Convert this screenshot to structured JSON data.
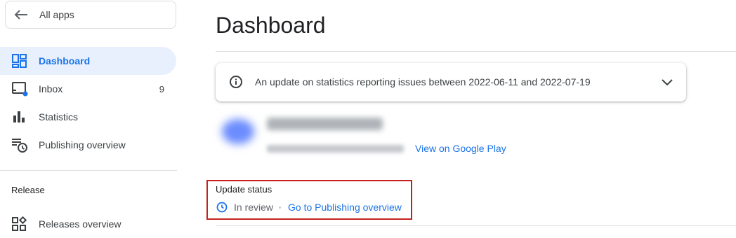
{
  "sidebar": {
    "back": {
      "label": "All apps",
      "icon": "arrow-left-icon"
    },
    "items": [
      {
        "label": "Dashboard",
        "icon": "dashboard-icon",
        "active": true
      },
      {
        "label": "Inbox",
        "icon": "inbox-icon",
        "count": "9"
      },
      {
        "label": "Statistics",
        "icon": "bar-chart-icon"
      },
      {
        "label": "Publishing overview",
        "icon": "publishing-overview-icon"
      }
    ],
    "section_label": "Release",
    "release_items": [
      {
        "label": "Releases overview",
        "icon": "releases-overview-icon"
      }
    ]
  },
  "main": {
    "title": "Dashboard",
    "notice": {
      "text": "An update on statistics reporting issues between 2022-06-11 and 2022-07-19",
      "icon": "info-icon",
      "toggle_icon": "chevron-down-icon"
    },
    "app": {
      "play_link": "View on Google Play"
    },
    "update_status": {
      "title": "Update status",
      "status": "In review",
      "link": "Go to Publishing overview",
      "icon": "clock-icon"
    }
  },
  "colors": {
    "accent": "#1a73e8",
    "active_bg": "#e8f0fe",
    "highlight_border": "#c5221f"
  }
}
